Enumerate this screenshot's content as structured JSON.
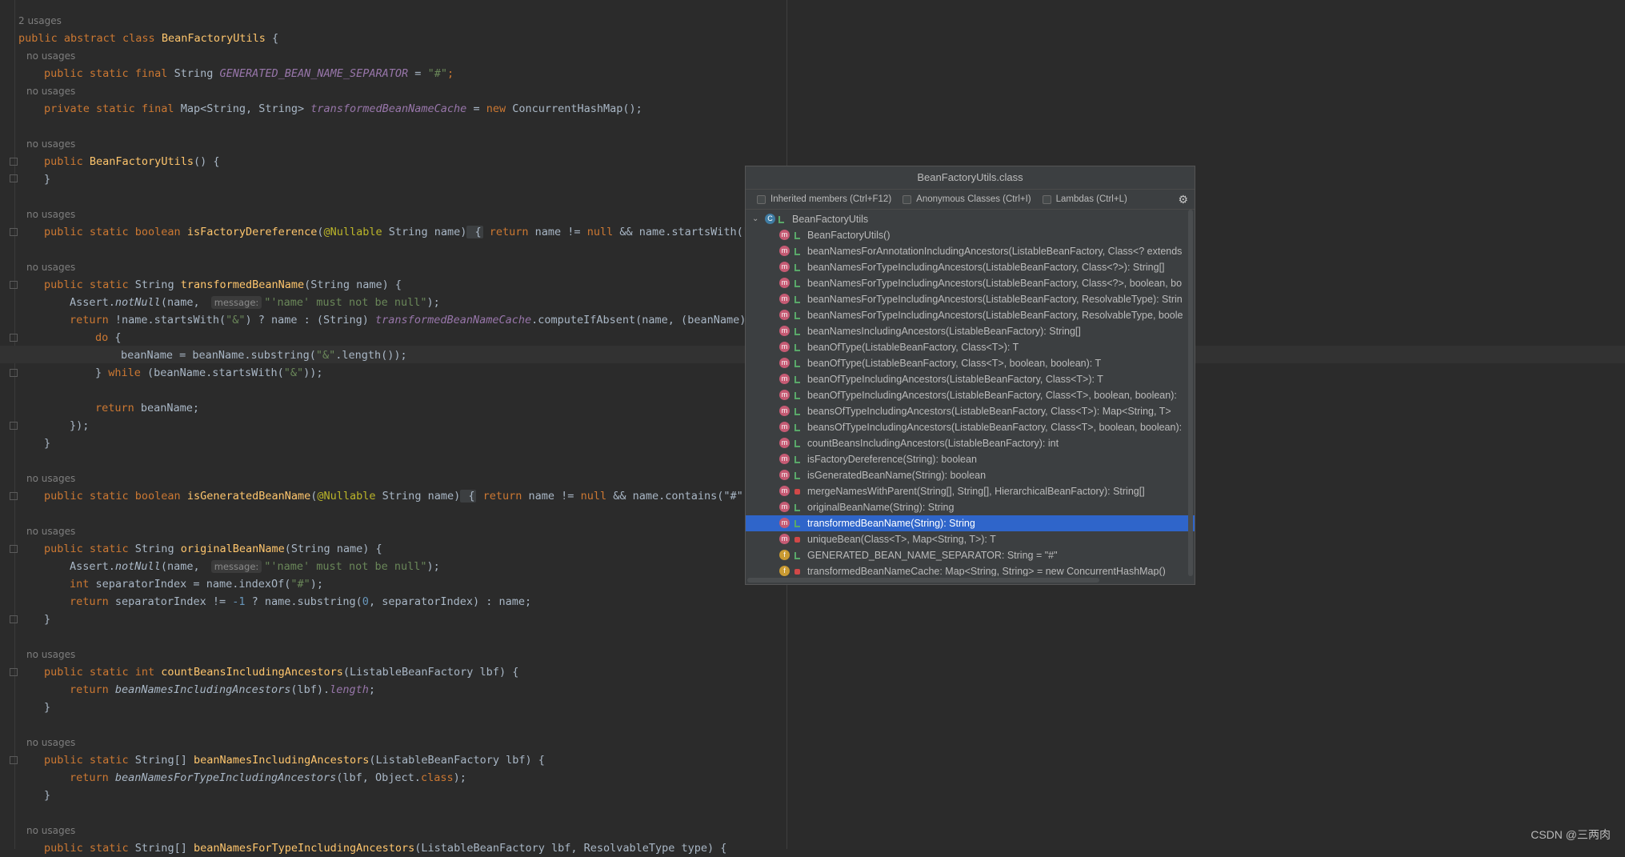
{
  "editor": {
    "usages_top": "2 usages",
    "no_usages": "no usages",
    "class_decl": {
      "kw": "public abstract class",
      "name": "BeanFactoryUtils",
      "rest": " {"
    },
    "lines": {
      "l1": {
        "kw": "public static final",
        "type": " String ",
        "field": "GENERATED_BEAN_NAME_SEPARATOR",
        "eq": " = ",
        "str": "\"#\"",
        "end": ";"
      },
      "l2": {
        "kw": "private static final",
        "type": " Map<String, String> ",
        "field": "transformedBeanNameCache",
        "eq": " = ",
        "kw2": "new",
        "rest": " ConcurrentHashMap();"
      },
      "l3": {
        "kw": "public",
        "name": " BeanFactoryUtils",
        "rest": "() {"
      },
      "l4": "}",
      "l5": {
        "kw": "public static boolean",
        "name": " isFactoryDereference",
        "p1": "(",
        "ann": "@Nullable",
        "p2": " String name)",
        "ret": "return",
        "rest": " name != ",
        "nul": "null",
        "rest2": " && name.startsWith(\"&\"",
        "sp": " "
      },
      "l6": {
        "kw": "public static",
        "type": " String ",
        "name": "transformedBeanName",
        "rest": "(String name) {"
      },
      "l7": {
        "pre": "Assert.",
        "call": "notNull",
        "a": "(name, ",
        "hint": "message:",
        "str": "\"'name' must not be null\"",
        "end": ");"
      },
      "l8": {
        "ret": "return",
        "rest": " !name.startsWith(",
        "str": "\"&\"",
        "rest2": ") ? name : (String) ",
        "field": "transformedBeanNameCache",
        "rest3": ".computeIfAbsent(name, (beanName) -"
      },
      "l9": {
        "kw": "do",
        "rest": " {"
      },
      "l10": {
        "pre": "beanName = beanName.substring(",
        "str": "\"&\"",
        "rest": ".length());"
      },
      "l11": {
        "pre": "} ",
        "kw": "while",
        "rest": " (beanName.startsWith(",
        "str": "\"&\"",
        "end": "));"
      },
      "l12": {
        "ret": "return",
        "rest": " beanName;"
      },
      "l13": "});",
      "l14": "}",
      "l15": {
        "kw": "public static boolean",
        "name": " isGeneratedBeanName",
        "p1": "(",
        "ann": "@Nullable",
        "p2": " String name)",
        "ret": "return",
        "rest": " name != ",
        "nul": "null",
        "rest2": " && name.contains(\"#\");"
      },
      "l16": {
        "kw": "public static",
        "type": " String ",
        "name": "originalBeanName",
        "rest": "(String name) {"
      },
      "l17": {
        "pre": "Assert.",
        "call": "notNull",
        "a": "(name, ",
        "hint": "message:",
        "str": "\"'name' must not be null\"",
        "end": ");"
      },
      "l18": {
        "kw": "int",
        "rest": " separatorIndex = name.indexOf(",
        "str": "\"#\"",
        "end": ");"
      },
      "l19": {
        "ret": "return",
        "rest": " separatorIndex != ",
        "num": "-1",
        "rest2": " ? name.substring(",
        "num2": "0",
        "rest3": ", separatorIndex) : name;"
      },
      "l20": "}",
      "l21": {
        "kw": "public static int",
        "name": " countBeansIncludingAncestors",
        "rest": "(ListableBeanFactory lbf) {"
      },
      "l22": {
        "ret": "return",
        "call": " beanNamesIncludingAncestors",
        "rest": "(lbf).",
        "field": "length",
        "end": ";"
      },
      "l23": "}",
      "l24": {
        "kw": "public static",
        "type": " String[] ",
        "name": "beanNamesIncludingAncestors",
        "rest": "(ListableBeanFactory lbf) {"
      },
      "l25": {
        "ret": "return",
        "call": " beanNamesForTypeIncludingAncestors",
        "rest": "(lbf, Object.",
        "kw": "class",
        "end": ");"
      },
      "l26": "}",
      "l27": {
        "kw": "public static",
        "type": " String[] ",
        "name": "beanNamesForTypeIncludingAncestors",
        "rest": "(ListableBeanFactory lbf, ResolvableType type) {"
      }
    }
  },
  "popup": {
    "title": "BeanFactoryUtils.class",
    "options": [
      {
        "label": "Inherited members (Ctrl+F12)"
      },
      {
        "label": "Anonymous Classes (Ctrl+I)"
      },
      {
        "label": "Lambdas (Ctrl+L)"
      }
    ],
    "root": "BeanFactoryUtils",
    "members": [
      {
        "label": "BeanFactoryUtils()",
        "kind": "m",
        "vis": "public"
      },
      {
        "label": "beanNamesForAnnotationIncludingAncestors(ListableBeanFactory, Class<? extends",
        "kind": "m",
        "vis": "public"
      },
      {
        "label": "beanNamesForTypeIncludingAncestors(ListableBeanFactory, Class<?>): String[]",
        "kind": "m",
        "vis": "public"
      },
      {
        "label": "beanNamesForTypeIncludingAncestors(ListableBeanFactory, Class<?>, boolean, bo",
        "kind": "m",
        "vis": "public"
      },
      {
        "label": "beanNamesForTypeIncludingAncestors(ListableBeanFactory, ResolvableType): Strin",
        "kind": "m",
        "vis": "public"
      },
      {
        "label": "beanNamesForTypeIncludingAncestors(ListableBeanFactory, ResolvableType, boole",
        "kind": "m",
        "vis": "public"
      },
      {
        "label": "beanNamesIncludingAncestors(ListableBeanFactory): String[]",
        "kind": "m",
        "vis": "public"
      },
      {
        "label": "beanOfType(ListableBeanFactory, Class<T>): T",
        "kind": "m",
        "vis": "public"
      },
      {
        "label": "beanOfType(ListableBeanFactory, Class<T>, boolean, boolean): T",
        "kind": "m",
        "vis": "public"
      },
      {
        "label": "beanOfTypeIncludingAncestors(ListableBeanFactory, Class<T>): T",
        "kind": "m",
        "vis": "public"
      },
      {
        "label": "beanOfTypeIncludingAncestors(ListableBeanFactory, Class<T>, boolean, boolean):",
        "kind": "m",
        "vis": "public"
      },
      {
        "label": "beansOfTypeIncludingAncestors(ListableBeanFactory, Class<T>): Map<String, T>",
        "kind": "m",
        "vis": "public"
      },
      {
        "label": "beansOfTypeIncludingAncestors(ListableBeanFactory, Class<T>, boolean, boolean):",
        "kind": "m",
        "vis": "public"
      },
      {
        "label": "countBeansIncludingAncestors(ListableBeanFactory): int",
        "kind": "m",
        "vis": "public"
      },
      {
        "label": "isFactoryDereference(String): boolean",
        "kind": "m",
        "vis": "public"
      },
      {
        "label": "isGeneratedBeanName(String): boolean",
        "kind": "m",
        "vis": "public"
      },
      {
        "label": "mergeNamesWithParent(String[], String[], HierarchicalBeanFactory): String[]",
        "kind": "m",
        "vis": "private"
      },
      {
        "label": "originalBeanName(String): String",
        "kind": "m",
        "vis": "public"
      },
      {
        "label": "transformedBeanName(String): String",
        "kind": "m",
        "vis": "public",
        "selected": true
      },
      {
        "label": "uniqueBean(Class<T>, Map<String, T>): T",
        "kind": "m",
        "vis": "private"
      },
      {
        "label": "GENERATED_BEAN_NAME_SEPARATOR: String = \"#\"",
        "kind": "f",
        "vis": "public"
      },
      {
        "label": "transformedBeanNameCache: Map<String, String> = new ConcurrentHashMap()",
        "kind": "f",
        "vis": "private"
      }
    ],
    "icon_letters": {
      "m": "m",
      "f": "f",
      "c": "C"
    }
  },
  "watermark": "CSDN @三两肉"
}
